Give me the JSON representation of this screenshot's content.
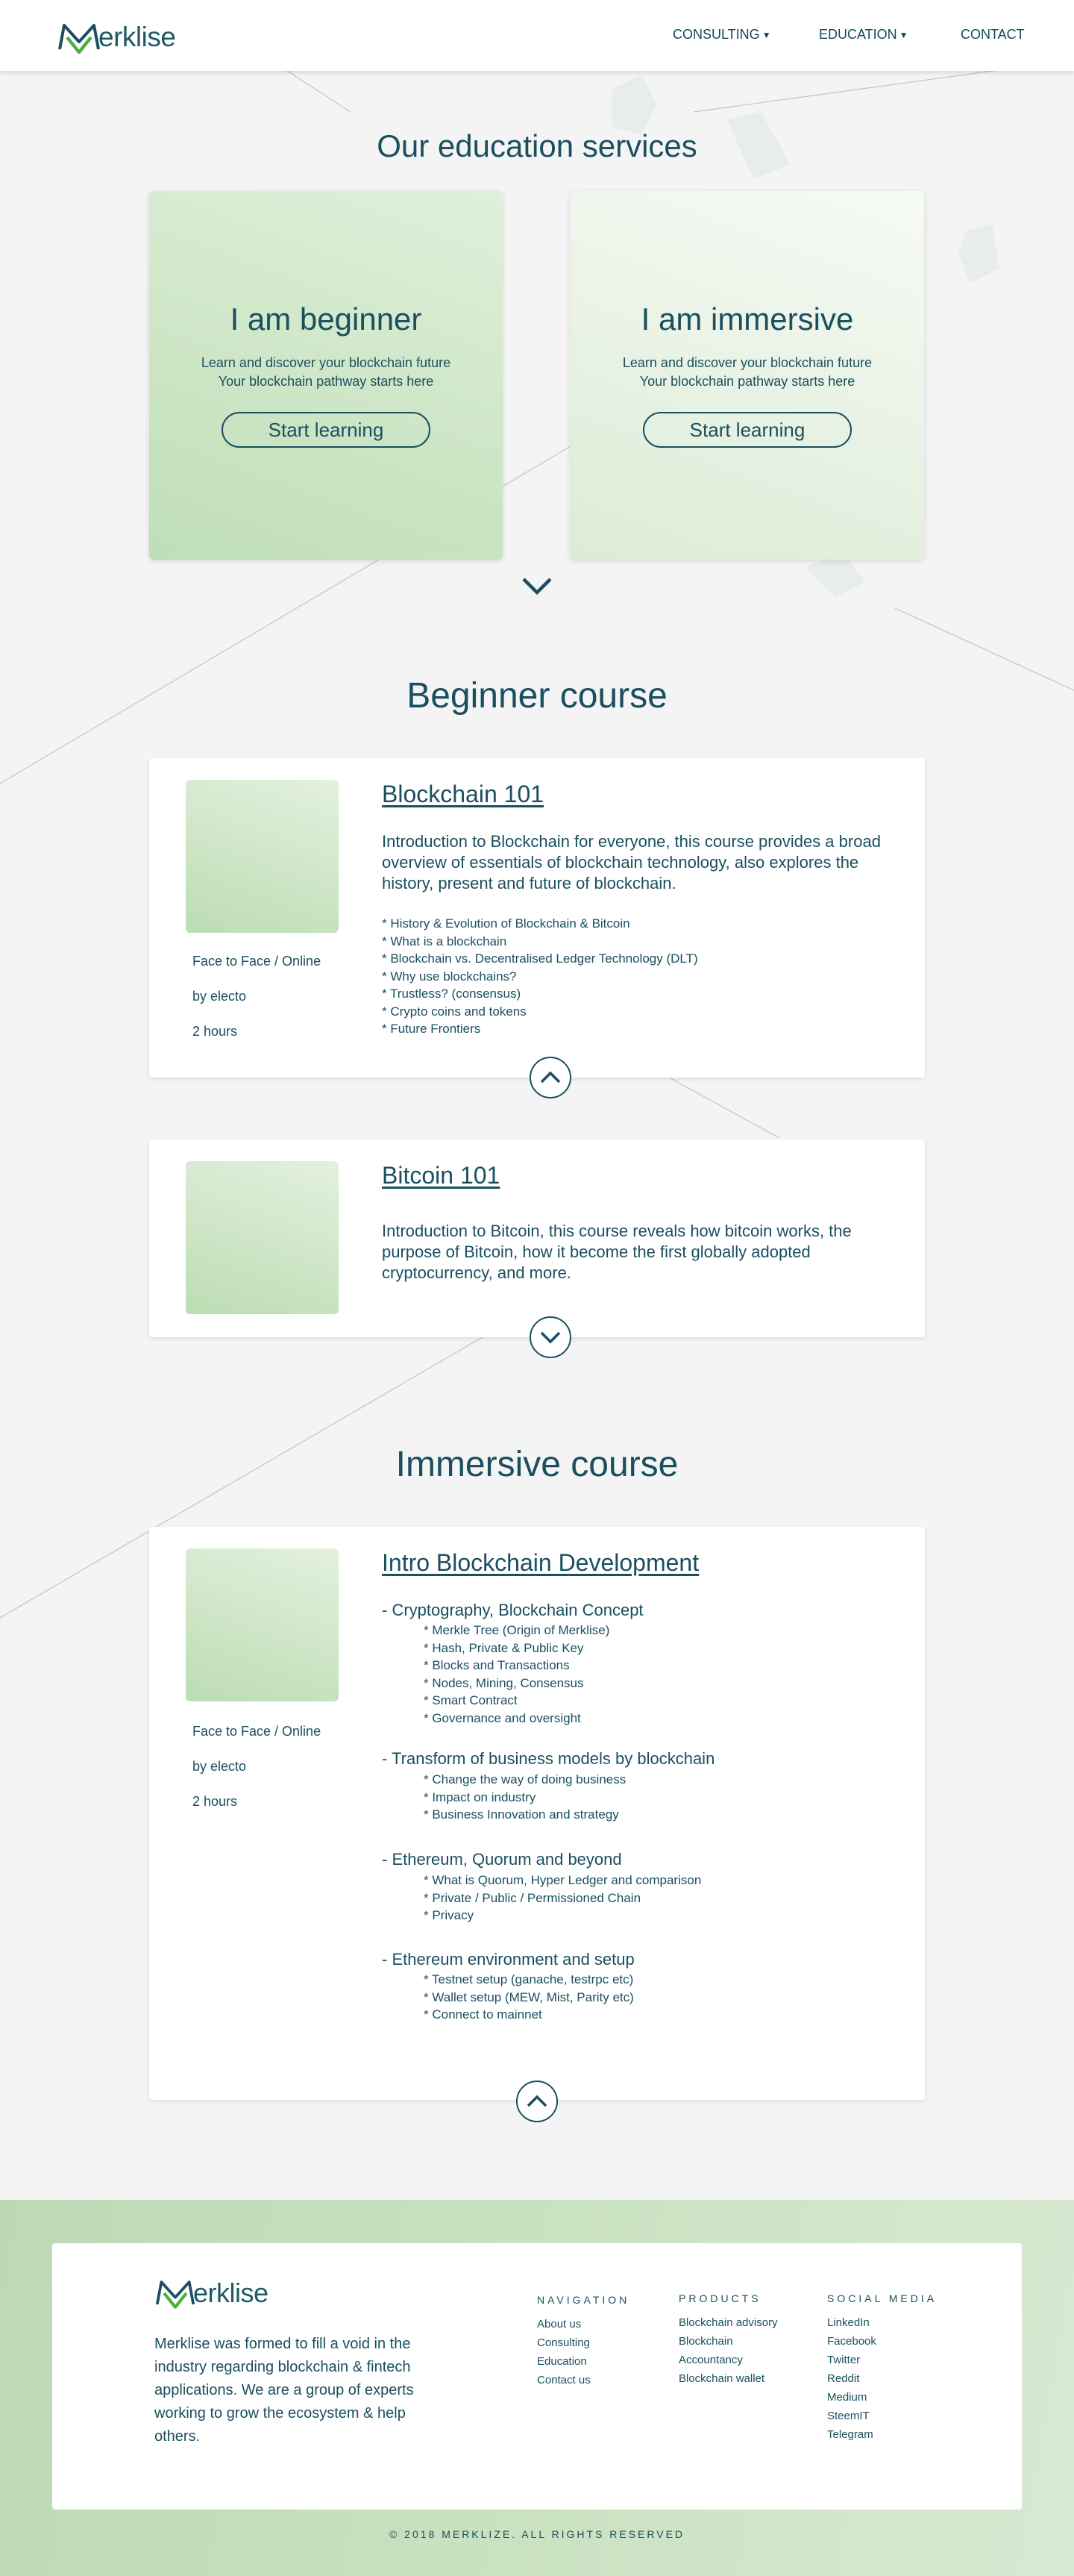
{
  "header": {
    "logo_text": "erklise",
    "nav": [
      {
        "label": "CONSULTING"
      },
      {
        "label": "EDUCATION"
      },
      {
        "label": "CONTACT"
      }
    ]
  },
  "services": {
    "title": "Our education services",
    "cards": [
      {
        "title": "I am beginner",
        "desc_line1": "Learn and discover your blockchain future",
        "desc_line2": "Your blockchain pathway starts here",
        "button": "Start learning"
      },
      {
        "title": "I am immersive",
        "desc_line1": "Learn and discover your blockchain future",
        "desc_line2": "Your blockchain pathway starts here",
        "button": "Start learning"
      }
    ]
  },
  "beginner": {
    "title": "Beginner course",
    "courses": [
      {
        "title": "Blockchain 101",
        "intro": "Introduction to Blockchain for everyone, this course provides a broad overview of essentials of blockchain technology, also explores the history, present and future of blockchain.",
        "mode": "Face to Face / Online",
        "by": "by electo",
        "duration": "2 hours",
        "topics": [
          "* History & Evolution of Blockchain & Bitcoin",
          "* What is a blockchain",
          "* Blockchain vs. Decentralised Ledger Technology (DLT)",
          "* Why use blockchains?",
          "* Trustless? (consensus)",
          "* Crypto coins and tokens",
          "* Future Frontiers"
        ]
      },
      {
        "title": "Bitcoin 101",
        "intro": "Introduction to Bitcoin, this course reveals how bitcoin works, the purpose of Bitcoin, how it become the first globally adopted cryptocurrency, and more."
      }
    ]
  },
  "immersive": {
    "title": "Immersive course",
    "course": {
      "title": "Intro Blockchain Development",
      "mode": "Face to Face / Online",
      "by": "by electo",
      "duration": "2 hours",
      "groups": [
        {
          "head": "- Cryptography, Blockchain Concept",
          "items": [
            "* Merkle Tree (Origin of Merklise)",
            "* Hash, Private & Public Key",
            "* Blocks and Transactions",
            "* Nodes, Mining, Consensus",
            "* Smart Contract",
            "* Governance and oversight"
          ]
        },
        {
          "head": "- Transform of business models by blockchain",
          "items": [
            "* Change the way of doing business",
            "* Impact on industry",
            "* Business Innovation and strategy"
          ]
        },
        {
          "head": "- Ethereum, Quorum and beyond",
          "items": [
            "* What is Quorum, Hyper Ledger and comparison",
            "* Private / Public / Permissioned Chain",
            "* Privacy"
          ]
        },
        {
          "head": "- Ethereum environment and setup",
          "items": [
            "* Testnet setup (ganache, testrpc etc)",
            "* Wallet setup (MEW, Mist, Parity etc)",
            "* Connect to mainnet"
          ]
        }
      ]
    }
  },
  "footer": {
    "logo_text": "erklise",
    "about": "Merklise was formed to fill a void in the industry regarding blockchain & fintech applications. We are a group of experts working to grow the ecosystem & help others.",
    "columns": [
      {
        "head": "NAVIGATION",
        "items": [
          "About us",
          "Consulting",
          "Education",
          "Contact us"
        ]
      },
      {
        "head": "PRODUCTS",
        "items": [
          "Blockchain advisory",
          "Blockchain",
          "Accountancy",
          "Blockchain wallet"
        ]
      },
      {
        "head": "SOCIAL MEDIA",
        "items": [
          "LinkedIn",
          "Facebook",
          "Twitter",
          "Reddit",
          "Medium",
          "SteemIT",
          "Telegram"
        ]
      }
    ],
    "copyright": "© 2018 MERKLIZE. ALL RIGHTS RESERVED"
  },
  "colors": {
    "primary": "#1a4f5f",
    "logo_green": "#4caf3d",
    "page_bg": "#f4f4f4",
    "card_green": "#bfdeb6"
  }
}
